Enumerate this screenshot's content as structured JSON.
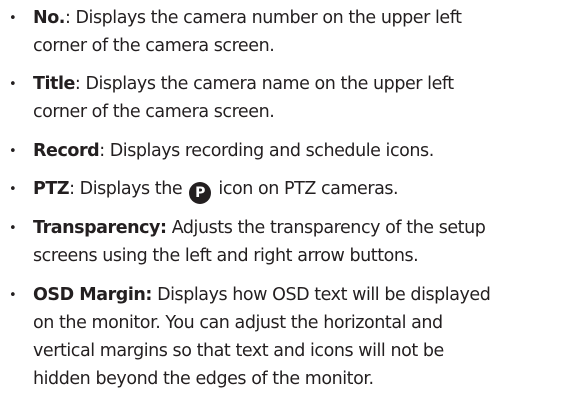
{
  "items": [
    {
      "term": "No.",
      "sep": ": ",
      "lines": [
        "Displays the camera number on the upper left",
        "corner of the camera screen."
      ]
    },
    {
      "term": "Title",
      "sep": ": ",
      "lines": [
        "Displays the camera name on the upper left",
        "corner of the camera screen."
      ]
    },
    {
      "term": "Record",
      "sep": ": ",
      "lines": [
        "Displays recording and schedule icons."
      ]
    },
    {
      "term": "PTZ",
      "sep": ": ",
      "before_icon": "Displays the ",
      "icon": "P",
      "icon_name": "ptz-p-icon",
      "after_icon": " icon on PTZ cameras."
    },
    {
      "term": "Transparency:",
      "sep": " ",
      "lines": [
        "Adjusts the transparency of the setup",
        "screens using the left and right arrow buttons."
      ]
    },
    {
      "term": "OSD Margin:",
      "sep": " ",
      "lines": [
        "Displays how OSD text will be displayed",
        "on the monitor. You can adjust the horizontal and",
        "vertical margins so that text and icons will not be",
        "hidden beyond the edges of the monitor."
      ]
    }
  ]
}
